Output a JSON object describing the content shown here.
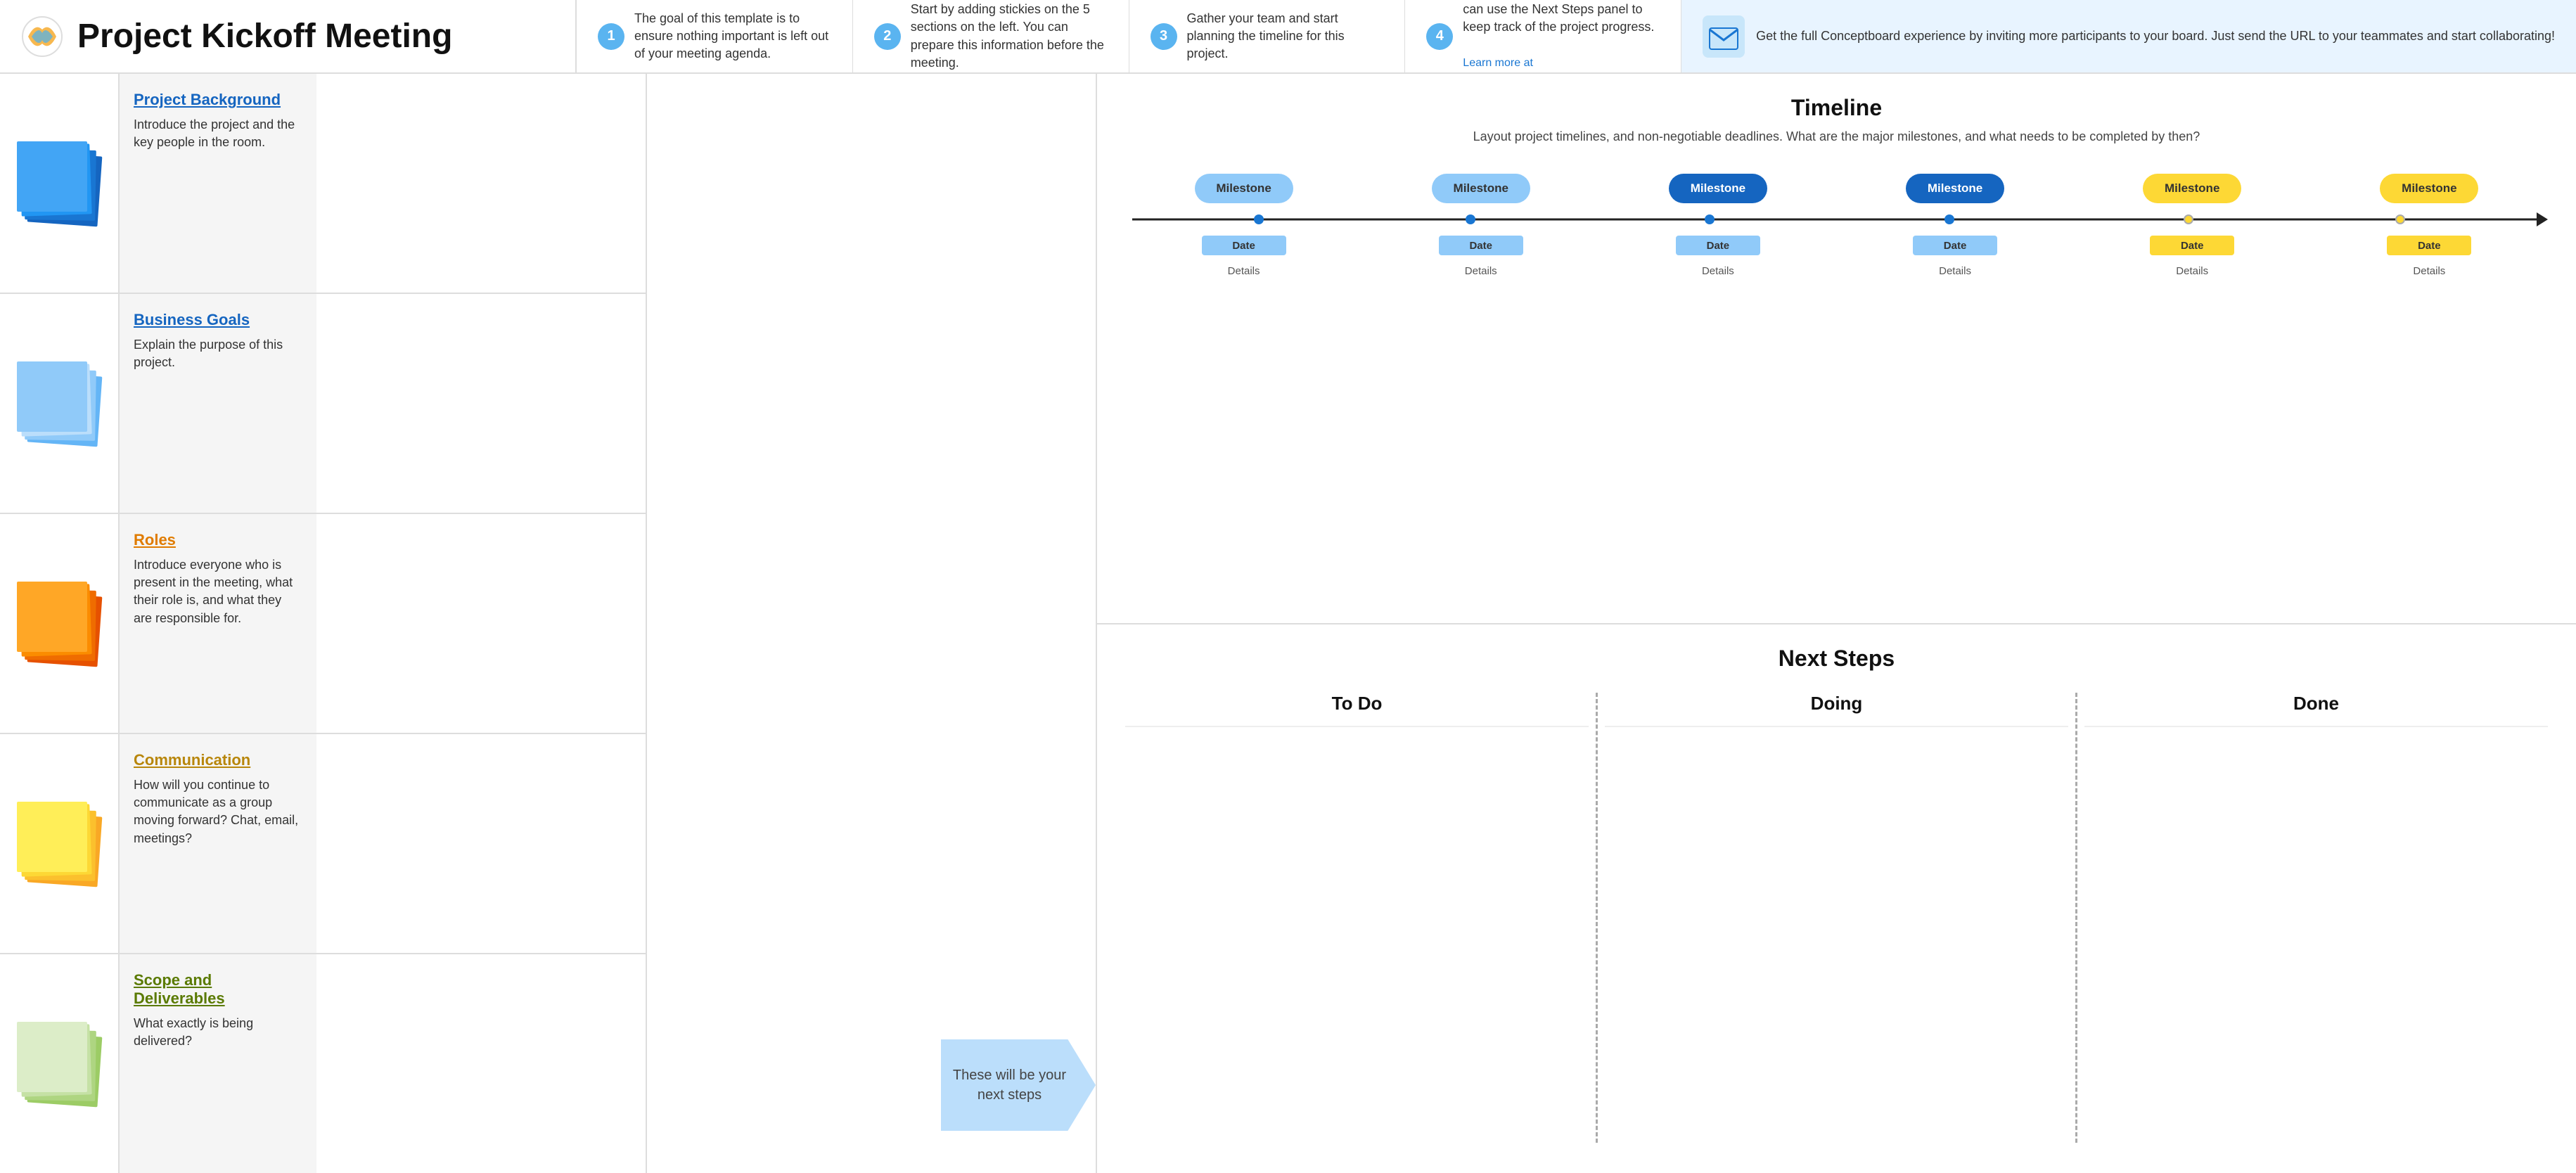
{
  "header": {
    "title": "Project Kickoff Meeting",
    "steps": [
      {
        "num": "1",
        "text": "The goal of this template is to ensure nothing important is left out of your meeting agenda."
      },
      {
        "num": "2",
        "text": "Start by adding stickies on the 5 sections on the left. You can prepare this information before the meeting."
      },
      {
        "num": "3",
        "text": "Gather your team and start planning the timeline for this project."
      },
      {
        "num": "4",
        "text": "Finally, define the next steps and assign responsibilities. Your team can use the Next Steps panel to keep track of the project progress.\n\nLearn more at https://conceptboard.com/blog/agile-product-roadmap-template/"
      }
    ],
    "cta": "Get the full Conceptboard experience by inviting more participants to your board. Just send the URL to your teammates and start collaborating!"
  },
  "sections": [
    {
      "title": "Project Background",
      "title_color": "blue-dark",
      "desc": "Introduce the project and the key people in the room.",
      "sticky_type": "blue"
    },
    {
      "title": "Business Goals",
      "title_color": "blue-dark",
      "desc": "Explain the purpose of this project.",
      "sticky_type": "light-blue"
    },
    {
      "title": "Roles",
      "title_color": "orange",
      "desc": "Introduce everyone who is present in the meeting, what their role is, and what they are responsible for.",
      "sticky_type": "orange"
    },
    {
      "title": "Communication",
      "title_color": "yellow",
      "desc": "How will you continue to communicate as a group moving forward? Chat, email, meetings?",
      "sticky_type": "yellow"
    },
    {
      "title": "Scope and Deliverables",
      "title_color": "green",
      "desc": "What exactly is being delivered?",
      "sticky_type": "green"
    }
  ],
  "timeline": {
    "title": "Timeline",
    "subtitle": "Layout project timelines, and non-negotiable deadlines. What are the major milestones, and what needs to be completed by then?",
    "milestones": [
      "Milestone",
      "Milestone",
      "Milestone",
      "Milestone",
      "Milestone",
      "Milestone"
    ],
    "milestone_colors": [
      "blue-light",
      "blue",
      "blue-dark",
      "blue-dark2",
      "yellow",
      "yellow2"
    ],
    "dates": [
      "Date",
      "Date",
      "Date",
      "Date",
      "Date",
      "Date"
    ],
    "date_colors": [
      "blue",
      "blue",
      "blue",
      "blue",
      "yellow",
      "yellow"
    ],
    "details": [
      "Details",
      "Details",
      "Details",
      "Details",
      "Details",
      "Details"
    ]
  },
  "next_steps": {
    "title": "Next Steps",
    "columns": [
      "To Do",
      "Doing",
      "Done"
    ],
    "arrow_text": "These will be your next steps"
  }
}
